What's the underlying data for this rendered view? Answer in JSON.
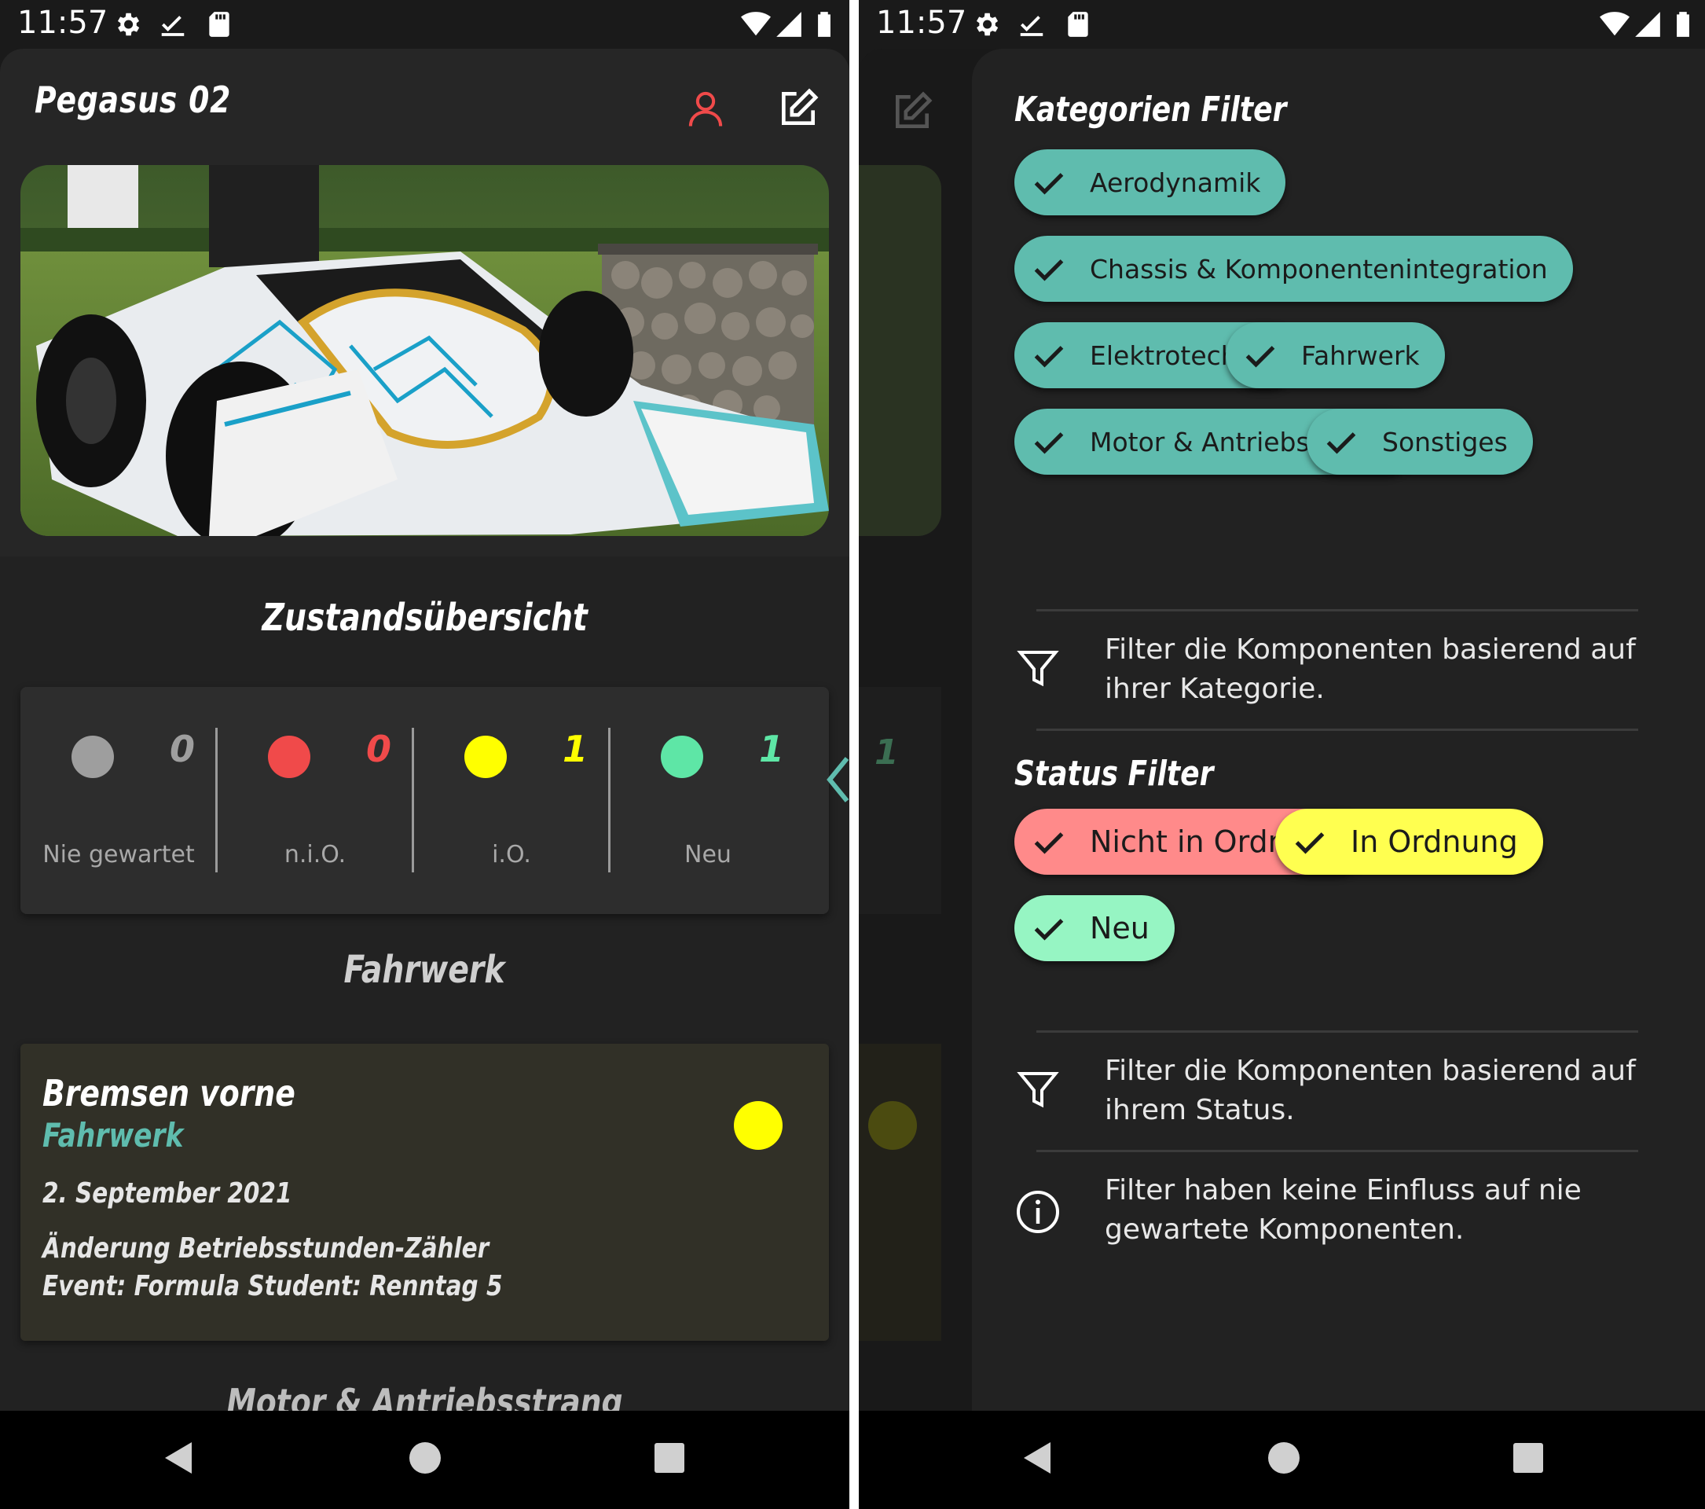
{
  "status_bar": {
    "time": "11:57"
  },
  "left": {
    "app_title": "Pegasus 02",
    "overview_title": "Zustandsübersicht",
    "summary": [
      {
        "label": "Nie gewartet",
        "count": "0",
        "color": "#9e9e9e"
      },
      {
        "label": "n.i.O.",
        "count": "0",
        "color": "#f04a4a"
      },
      {
        "label": "i.O.",
        "count": "1",
        "color": "#ffff00"
      },
      {
        "label": "Neu",
        "count": "1",
        "color": "#5ee6a6"
      }
    ],
    "category_heading": "Fahrwerk",
    "component": {
      "name": "Bremsen vorne",
      "category": "Fahrwerk",
      "date": "2. September 2021",
      "line1": "Änderung Betriebsstunden-Zähler",
      "line2": "Event: Formula Student: Renntag 5",
      "status_color": "#ffff00"
    },
    "next_heading": "Motor & Antriebsstrang"
  },
  "right": {
    "category_filter_title": "Kategorien Filter",
    "category_chips": [
      {
        "label": "Aerodynamik"
      },
      {
        "label": "Chassis & Komponentenintegration"
      },
      {
        "label": "Elektrotechnik"
      },
      {
        "label": "Fahrwerk"
      },
      {
        "label": "Motor & Antriebsstrang"
      },
      {
        "label": "Sonstiges"
      }
    ],
    "category_hint": "Filter die Komponenten basierend auf ihrer Kategorie.",
    "status_filter_title": "Status Filter",
    "status_chips": [
      {
        "label": "Nicht in Ordnung",
        "color": "#ff8a8a"
      },
      {
        "label": "In Ordnung",
        "color": "#ffff50"
      },
      {
        "label": "Neu",
        "color": "#96f5c3"
      }
    ],
    "status_hint": "Filter die Komponenten basierend auf ihrem Status.",
    "info_hint": "Filter haben keine Einfluss auf nie gewartete Komponenten.",
    "dimmed_count": "1"
  },
  "colors": {
    "accent": "#5fbcae",
    "user_icon": "#f04a4a"
  }
}
